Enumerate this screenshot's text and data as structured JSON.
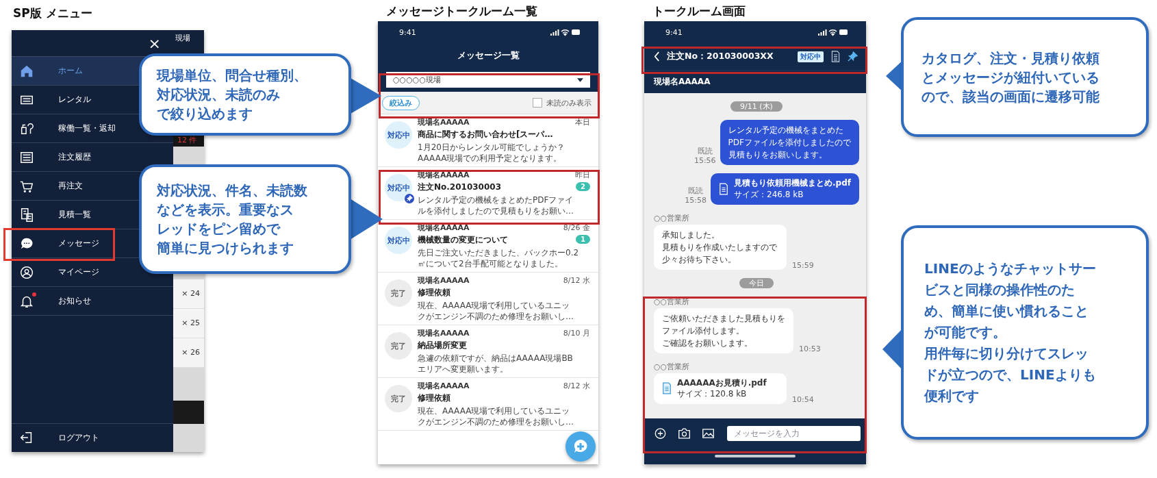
{
  "menu_screen": {
    "title": "SP版 メニュー",
    "close": "×",
    "items": [
      {
        "label": "ホーム",
        "selected": true,
        "notification": false
      },
      {
        "label": "レンタル",
        "selected": false,
        "notification": false
      },
      {
        "label": "稼働一覧・返却",
        "selected": false,
        "notification": false
      },
      {
        "label": "注文履歴",
        "selected": false,
        "notification": false
      },
      {
        "label": "再注文",
        "selected": false,
        "notification": false
      },
      {
        "label": "見積一覧",
        "selected": false,
        "notification": false
      },
      {
        "label": "メッセージ",
        "selected": false,
        "notification": false
      },
      {
        "label": "マイページ",
        "selected": false,
        "notification": false
      },
      {
        "label": "お知らせ",
        "selected": false,
        "notification": true
      }
    ],
    "logout": "ログアウト",
    "behind": {
      "header": "現場",
      "count": "12 件",
      "quantities": [
        "× 24",
        "× 25",
        "× 26"
      ]
    }
  },
  "list_screen": {
    "title": "メッセージトークルーム一覧",
    "time": "9:41",
    "header": "メッセージ一覧",
    "site_select": "○○○○○現場",
    "filter_button": "絞込み",
    "unread_only": {
      "label": "未読のみ表示",
      "checked": false
    },
    "threads": [
      {
        "kind": "open",
        "status": "対応中",
        "site": "現場名AAAAA",
        "subject": "商品に関するお問い合わせ[スーパ…",
        "preview": [
          "1月20日からレンタル可能でしょうか？",
          "AAAAA現場での利用予定となります。"
        ],
        "date": "本日",
        "pinned": false
      },
      {
        "kind": "open",
        "status": "対応中",
        "site": "現場名AAAAA",
        "subject": "注文No.201030003",
        "preview": [
          "レンタル予定の機械をまとめたPDFファイ",
          "ルを添付しましたので見積もりをお願い…"
        ],
        "date": "昨日",
        "unread": "2",
        "pinned": true
      },
      {
        "kind": "open",
        "status": "対応中",
        "site": "現場名AAAAA",
        "subject": "機械数量の変更について",
        "preview": [
          "先日ご注文いただきました、バックホー0.2",
          "㎥について2台手配可能となりました。"
        ],
        "date": "8/26 金",
        "unread": "1",
        "pinned": false
      },
      {
        "kind": "done",
        "status": "完了",
        "site": "現場名AAAAA",
        "subject": "修理依頼",
        "preview": [
          "現在、AAAAA現場で利用しているユニッ",
          "クがエンジン不調のため修理をお願いし…"
        ],
        "date": "8/12 水",
        "pinned": false
      },
      {
        "kind": "done",
        "status": "完了",
        "site": "現場名AAAAA",
        "subject": "納品場所変更",
        "preview": [
          "急遽の依頼ですが、納品はAAAAA現場BB",
          "エリアへ変更願います。"
        ],
        "date": "8/10 月",
        "pinned": false
      },
      {
        "kind": "done",
        "status": "完了",
        "site": "現場名AAAAA",
        "subject": "修理依頼",
        "preview": [
          "現在、AAAAA現場で利用しているユニッ",
          "クがエンジン不調のため修理をお願いし…"
        ],
        "date": "8/12 水",
        "pinned": false
      }
    ]
  },
  "chat_screen": {
    "title": "トークルーム画面",
    "time": "9:41",
    "order": "注文No：201030003XX",
    "status": "対応中",
    "site": "現場名AAAAA",
    "messages": [
      {
        "kind": "date",
        "text": "9/11 (木)"
      },
      {
        "kind": "sent_text",
        "lines": [
          "レンタル予定の機械をまとめた",
          "PDFファイルを添付しましたので",
          "見積もりをお願いします。"
        ],
        "read": "既読",
        "time": "15:56"
      },
      {
        "kind": "sent_file",
        "file": "見積もり依頼用機械まとめ.pdf",
        "size": "サイズ：246.8 kB",
        "read": "既読",
        "time": "15:58"
      },
      {
        "kind": "received_text",
        "sender": "○○営業所",
        "lines": [
          "承知しました。",
          "見積もりを作成いたしますので",
          "少々お待ち下さい。"
        ],
        "time": "15:59"
      },
      {
        "kind": "date",
        "text": "今日"
      },
      {
        "kind": "received_text",
        "sender": "○○営業所",
        "lines": [
          "ご依頼いただきました見積もりを",
          "ファイル添付します。",
          "ご確認をお願いします。"
        ],
        "time": "10:53"
      },
      {
        "kind": "received_file",
        "sender": "○○営業所",
        "file": "AAAAAAお見積り.pdf",
        "size": "サイズ：120.8 kB",
        "time": "10:54"
      }
    ],
    "input_placeholder": "メッセージを入力"
  },
  "callouts": [
    {
      "lines": [
        "現場単位、問合せ種別、",
        "対応状況、未読のみ",
        "で絞り込めます"
      ]
    },
    {
      "lines": [
        "対応状況、件名、未読数",
        "などを表示。重要なス",
        "レッドをピン留めで",
        "簡単に見つけられます"
      ]
    },
    {
      "lines": [
        "カタログ、注文・見積り依頼",
        "とメッセージが紐付いている",
        "ので、該当の画面に遷移可能"
      ]
    },
    {
      "lines": [
        "LINEのようなチャットサー",
        "ビスと同様の操作性のた",
        "め、簡単に使い慣れること",
        "が可能です。",
        "用件毎に切り分けてスレッ",
        "ドが立つので、LINEよりも",
        "便利です"
      ]
    }
  ]
}
